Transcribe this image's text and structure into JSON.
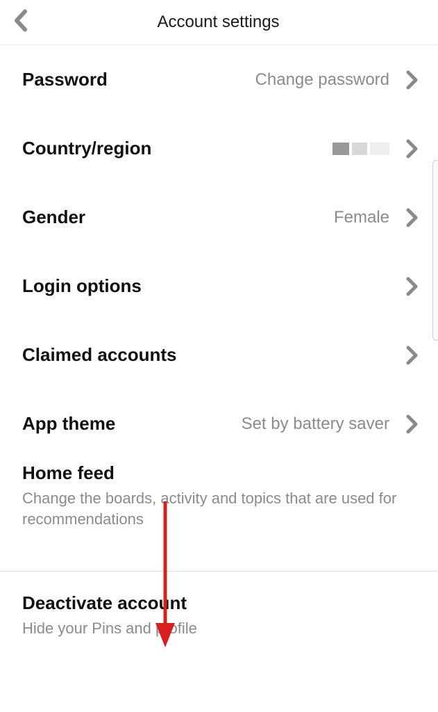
{
  "header": {
    "title": "Account settings"
  },
  "settings": {
    "password": {
      "label": "Password",
      "value": "Change password"
    },
    "country": {
      "label": "Country/region"
    },
    "gender": {
      "label": "Gender",
      "value": "Female"
    },
    "login_options": {
      "label": "Login options"
    },
    "claimed_accounts": {
      "label": "Claimed accounts"
    },
    "app_theme": {
      "label": "App theme",
      "value": "Set by battery saver"
    },
    "home_feed": {
      "label": "Home feed",
      "description": "Change the boards, activity and topics that are used for recommendations"
    },
    "deactivate": {
      "label": "Deactivate account",
      "description": "Hide your Pins and profile"
    }
  },
  "colors": {
    "chevron": "#8a8a8a",
    "arrow": "#d81e1e"
  }
}
